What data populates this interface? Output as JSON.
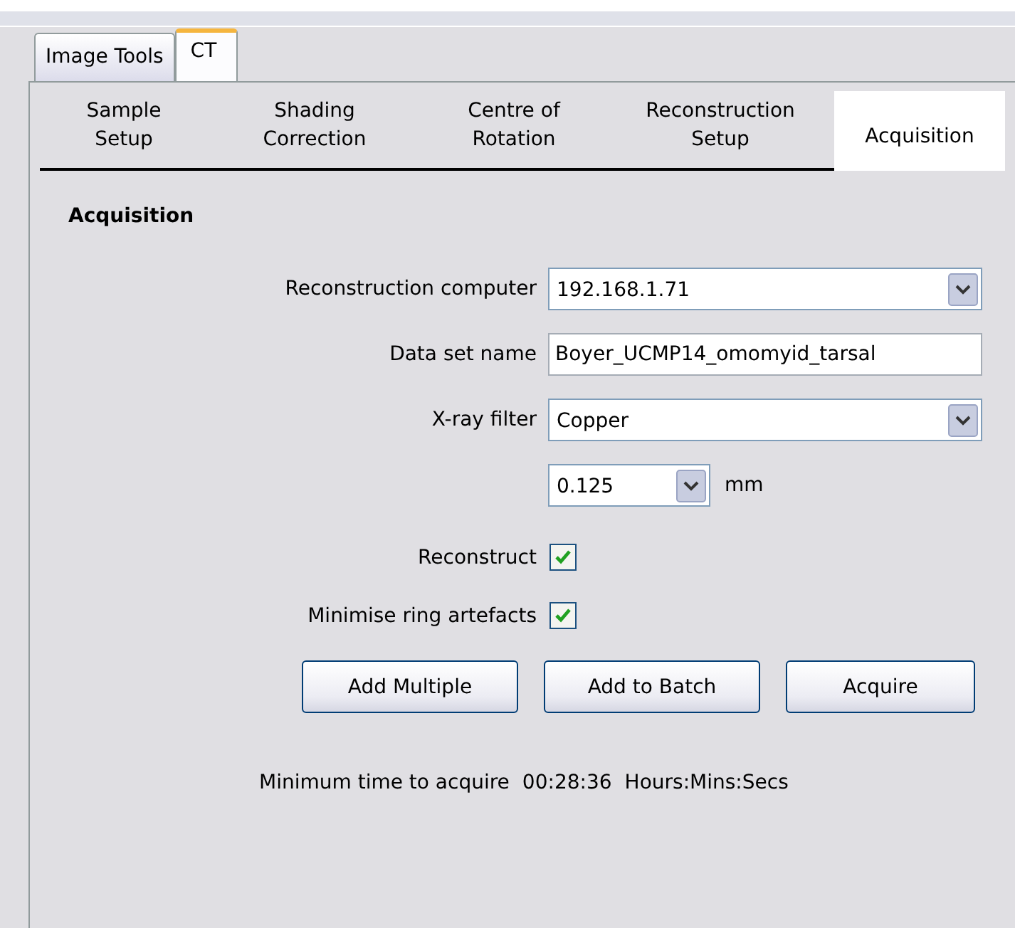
{
  "tabs": [
    {
      "label": "Image Tools",
      "selected": false
    },
    {
      "label": "CT",
      "selected": true
    }
  ],
  "sub_tabs": [
    {
      "label": "Sample\nSetup",
      "selected": false
    },
    {
      "label": "Shading\nCorrection",
      "selected": false
    },
    {
      "label": "Centre of\nRotation",
      "selected": false
    },
    {
      "label": "Reconstruction\nSetup",
      "selected": false
    },
    {
      "label": "Acquisition",
      "selected": true
    }
  ],
  "section_title": "Acquisition",
  "fields": [
    {
      "kind": "combo",
      "label": "Reconstruction computer",
      "value": "192.168.1.71"
    },
    {
      "kind": "text",
      "label": "Data set name",
      "value": "Boyer_UCMP14_omomyid_tarsal"
    },
    {
      "kind": "combo",
      "label": "X-ray filter",
      "value": "Copper"
    },
    {
      "kind": "small_combo",
      "value": "0.125",
      "unit": "mm"
    }
  ],
  "checkboxes": [
    {
      "label": "Reconstruct",
      "checked": true
    },
    {
      "label": "Minimise ring artefacts",
      "checked": true
    }
  ],
  "buttons": [
    "Add Multiple",
    "Add to Batch",
    "Acquire"
  ],
  "time": {
    "label": "Minimum time to acquire",
    "value": "00:28:36",
    "unit": "Hours:Mins:Secs"
  }
}
